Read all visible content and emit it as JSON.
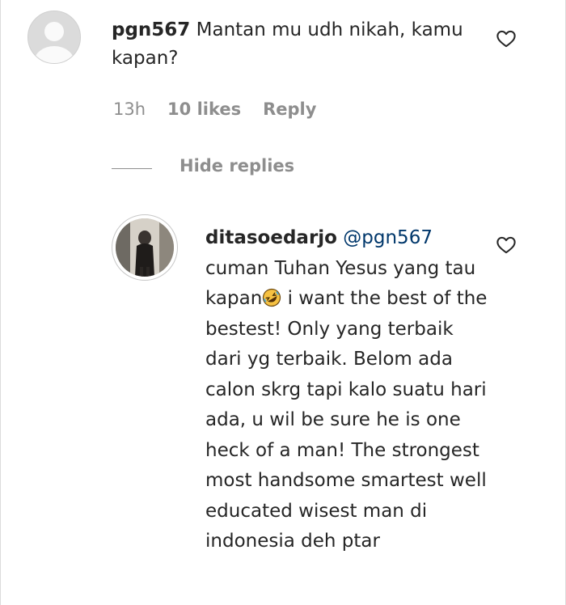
{
  "comment": {
    "username": "pgn567",
    "text": "Mantan mu udh nikah, kamu kapan?",
    "time": "13h",
    "likes": "10 likes",
    "reply_label": "Reply"
  },
  "replies": {
    "hide_label": "Hide replies"
  },
  "reply": {
    "username": "ditasoedarjo",
    "mention": "@pgn567",
    "text_before_emoji": "cuman Tuhan Yesus yang tau kapan",
    "emoji": "rolling-on-floor-laughing-emoji",
    "text_after_emoji": " i want the best of the bestest! Only yang terbaik dari yg terbaik. Belom ada calon skrg tapi kalo suatu hari ada, u wil be sure he is one heck of a man! The strongest most handsome smartest well educated wisest man di indonesia deh ptar"
  },
  "colors": {
    "text": "#262626",
    "secondary": "#8e8e8e",
    "mention": "#00376b",
    "avatar_bg": "#dbdbdb"
  },
  "icons": {
    "like": "heart-outline-icon",
    "default_avatar": "default-avatar-icon"
  }
}
